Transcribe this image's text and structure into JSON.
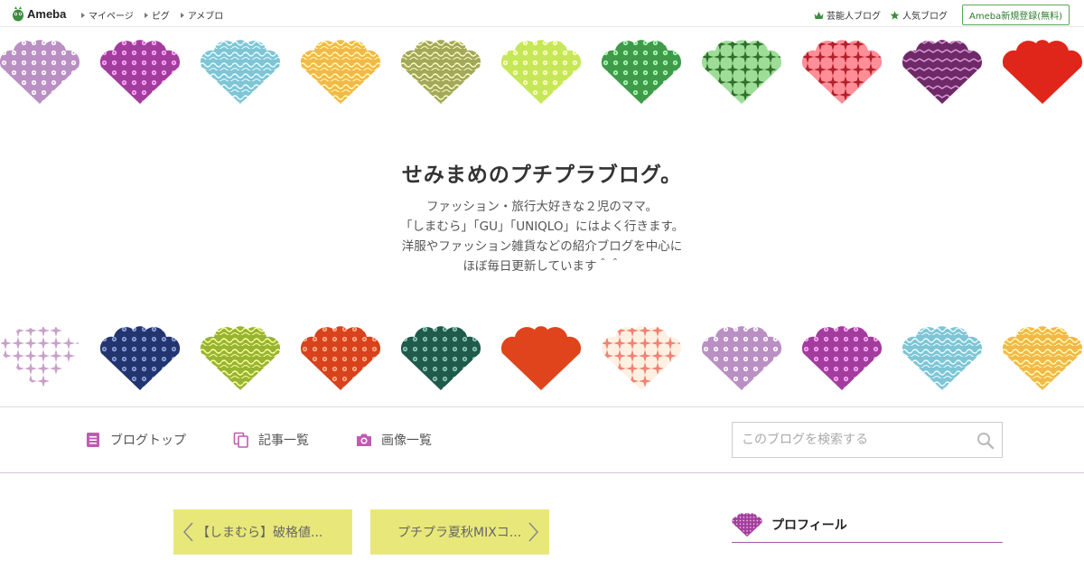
{
  "topbar": {
    "logo_text": "Ameba",
    "nav_left": [
      "マイページ",
      "ピグ",
      "アメブロ"
    ],
    "celebrity_blog": "芸能人ブログ",
    "popular_blog": "人気ブログ",
    "register": "Ameba新規登録(無料)"
  },
  "header": {
    "title": "せみまめのプチプラブログ。",
    "description": [
      "ファッション・旅行大好きな２児のママ。",
      "「しまむら」「GU」「UNIQLO」にはよく行きます。",
      "洋服やファッション雑貨などの紹介ブログを中心に",
      "ほぼ毎日更新しています＾＾"
    ]
  },
  "fans_top": [
    {
      "color": "#b98fc4",
      "pattern": "dots"
    },
    {
      "color": "#a33d9d",
      "pattern": "dots"
    },
    {
      "color": "#7fc5d6",
      "pattern": "waves"
    },
    {
      "color": "#f2b94a",
      "pattern": "waves"
    },
    {
      "color": "#a3a85a",
      "pattern": "waves"
    },
    {
      "color": "#c7e75a",
      "pattern": "dots"
    },
    {
      "color": "#3f9a4a",
      "pattern": "dots"
    },
    {
      "color": "#2f6f2a",
      "pattern": "stars"
    },
    {
      "color": "#b3202a",
      "pattern": "stars"
    },
    {
      "color": "#6e2a68",
      "pattern": "zigzag"
    },
    {
      "color": "#e0261a",
      "pattern": "solid"
    }
  ],
  "fans_bottom": [
    {
      "color": "#c9a0c9",
      "pattern": "stars"
    },
    {
      "color": "#22356f",
      "pattern": "dots"
    },
    {
      "color": "#97b532",
      "pattern": "waves"
    },
    {
      "color": "#d8421c",
      "pattern": "dots"
    },
    {
      "color": "#1f5a4a",
      "pattern": "dots"
    },
    {
      "color": "#e0441c",
      "pattern": "solid"
    },
    {
      "color": "#f08274",
      "pattern": "stars"
    },
    {
      "color": "#b98fc4",
      "pattern": "dots"
    },
    {
      "color": "#a33d9d",
      "pattern": "dots"
    },
    {
      "color": "#7fc5d6",
      "pattern": "waves"
    },
    {
      "color": "#f2b94a",
      "pattern": "waves"
    }
  ],
  "nav": {
    "blog_top": "ブログトップ",
    "article_list": "記事一覧",
    "image_list": "画像一覧",
    "search_placeholder": "このブログを検索する"
  },
  "pager": {
    "prev": "【しまむら】破格値...",
    "next": "プチプラ夏秋MIXコ..."
  },
  "profile": {
    "title": "プロフィール"
  },
  "colors": {
    "accent_purple": "#a25aa1",
    "pager_bg": "#e8e87a",
    "ameba_green": "#2d7d2d",
    "nav_icon": "#c05cb0"
  }
}
